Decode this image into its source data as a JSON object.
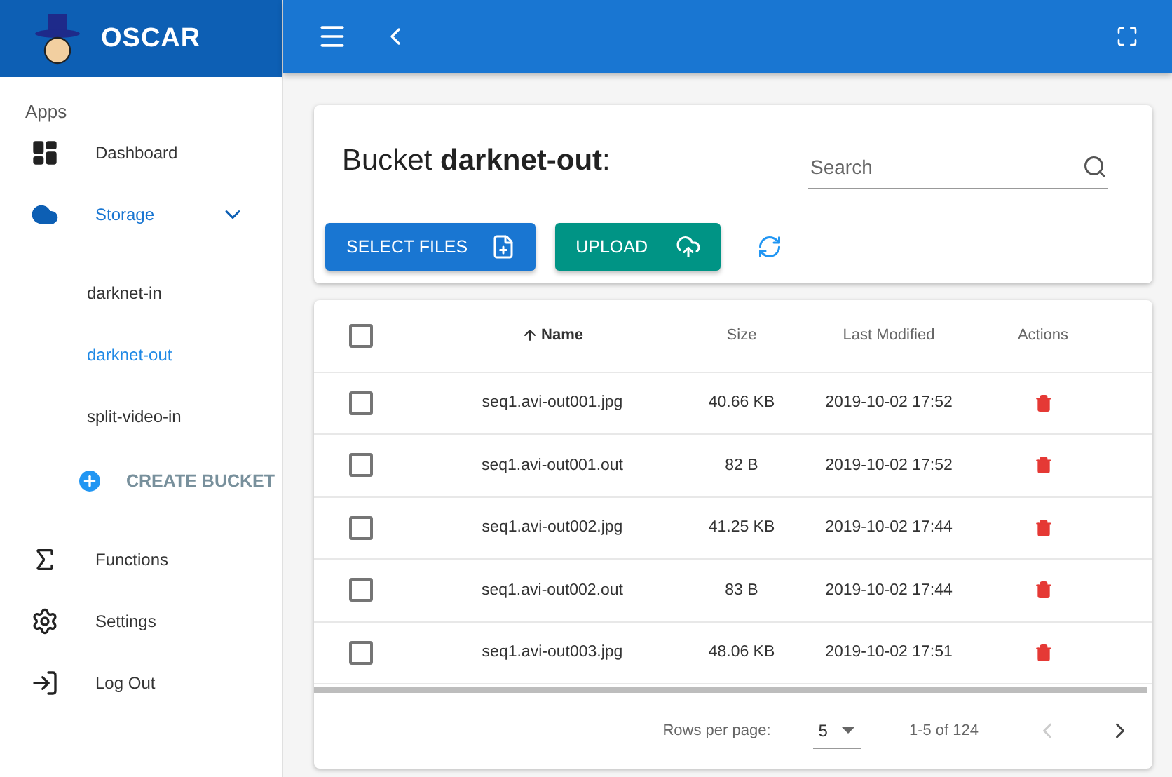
{
  "app": {
    "title": "OSCAR"
  },
  "sidebar": {
    "heading": "Apps",
    "items": [
      {
        "label": "Dashboard",
        "selected": false
      },
      {
        "label": "Storage",
        "selected": true,
        "expanded": true,
        "children": [
          {
            "label": "darknet-in",
            "selected": false
          },
          {
            "label": "darknet-out",
            "selected": true
          },
          {
            "label": "split-video-in",
            "selected": false
          }
        ],
        "action": "CREATE BUCKET"
      },
      {
        "label": "Functions",
        "selected": false
      },
      {
        "label": "Settings",
        "selected": false
      },
      {
        "label": "Log Out",
        "selected": false
      }
    ]
  },
  "bucket": {
    "prefix": "Bucket",
    "name": "darknet-out",
    "suffix": ":"
  },
  "search": {
    "placeholder": "Search"
  },
  "buttons": [
    {
      "label": "SELECT FILES",
      "kind": "select"
    },
    {
      "label": "UPLOAD",
      "kind": "upload"
    }
  ],
  "table": {
    "columns": [
      {
        "label": "Name",
        "sorted": true
      },
      {
        "label": "Size",
        "sorted": false
      },
      {
        "label": "Last Modified",
        "sorted": false
      },
      {
        "label": "Actions",
        "sorted": false
      }
    ],
    "all_checked": false,
    "rows": [
      {
        "checked": false,
        "name": "seq1.avi-out001.jpg",
        "size": "40.66 KB",
        "modified": "2019-10-02 17:52"
      },
      {
        "checked": false,
        "name": "seq1.avi-out001.out",
        "size": "82 B",
        "modified": "2019-10-02 17:52"
      },
      {
        "checked": false,
        "name": "seq1.avi-out002.jpg",
        "size": "41.25 KB",
        "modified": "2019-10-02 17:44"
      },
      {
        "checked": false,
        "name": "seq1.avi-out002.out",
        "size": "83 B",
        "modified": "2019-10-02 17:44"
      },
      {
        "checked": false,
        "name": "seq1.avi-out003.jpg",
        "size": "48.06 KB",
        "modified": "2019-10-02 17:51"
      }
    ]
  },
  "pagination": {
    "label": "Rows per page:",
    "rows_per_page": "5",
    "range": "1-5 of 124",
    "prev_disabled": true,
    "next_disabled": false
  }
}
